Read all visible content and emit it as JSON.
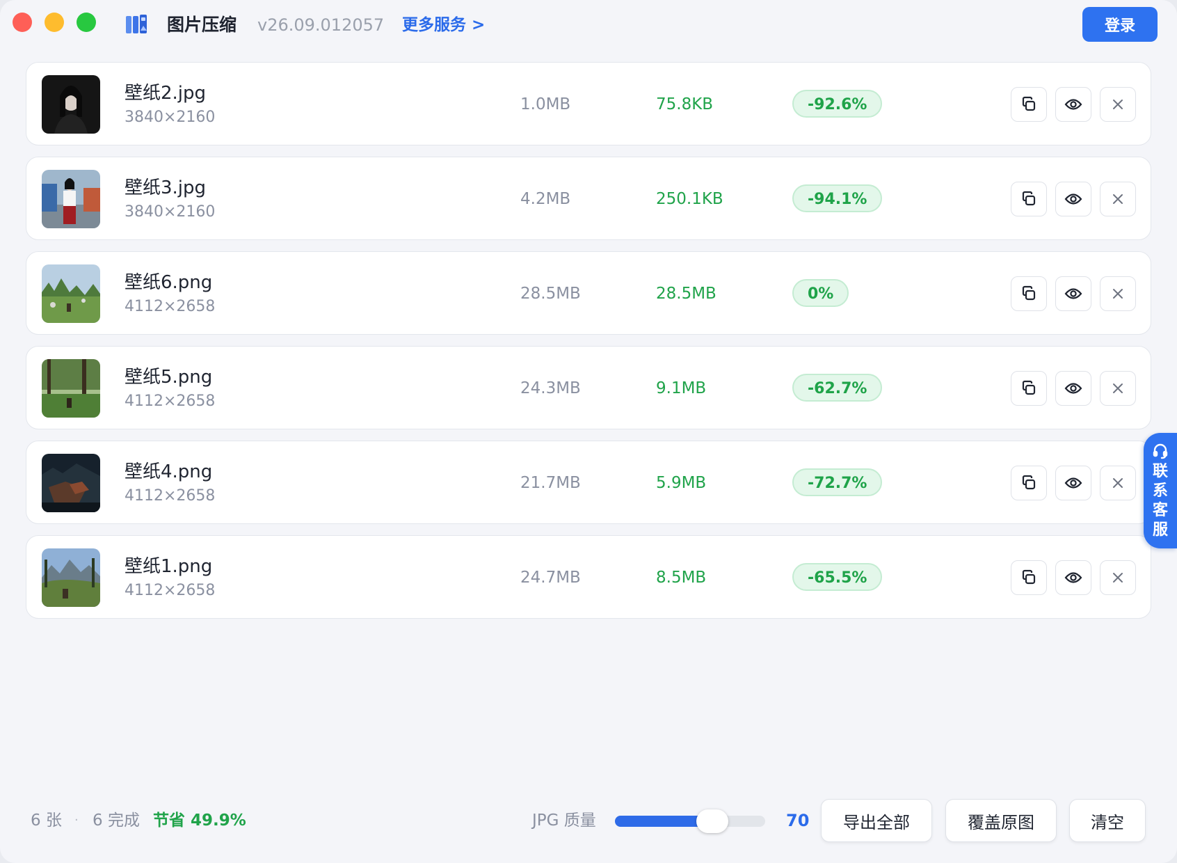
{
  "app": {
    "title": "图片压缩",
    "version": "v26.09.012057",
    "more_services": "更多服务 >",
    "login": "登录"
  },
  "files": [
    {
      "name": "壁纸2.jpg",
      "dims": "3840×2160",
      "orig": "1.0MB",
      "new": "75.8KB",
      "ratio": "-92.6%",
      "thumb": "portrait-dark"
    },
    {
      "name": "壁纸3.jpg",
      "dims": "3840×2160",
      "orig": "4.2MB",
      "new": "250.1KB",
      "ratio": "-94.1%",
      "thumb": "portrait-street"
    },
    {
      "name": "壁纸6.png",
      "dims": "4112×2658",
      "orig": "28.5MB",
      "new": "28.5MB",
      "ratio": "0%",
      "thumb": "landscape-meadow"
    },
    {
      "name": "壁纸5.png",
      "dims": "4112×2658",
      "orig": "24.3MB",
      "new": "9.1MB",
      "ratio": "-62.7%",
      "thumb": "landscape-forest"
    },
    {
      "name": "壁纸4.png",
      "dims": "4112×2658",
      "orig": "21.7MB",
      "new": "5.9MB",
      "ratio": "-72.7%",
      "thumb": "landscape-night"
    },
    {
      "name": "壁纸1.png",
      "dims": "4112×2658",
      "orig": "24.7MB",
      "new": "8.5MB",
      "ratio": "-65.5%",
      "thumb": "landscape-mountain"
    }
  ],
  "row_actions": {
    "copy_icon": "copy-icon",
    "preview_icon": "eye-icon",
    "remove_icon": "close-icon"
  },
  "contact": {
    "label": "联系客服",
    "icon": "headset-icon"
  },
  "footer": {
    "count": "6 张",
    "separator": "·",
    "done": "6 完成",
    "saved": "节省 49.9%",
    "quality_label": "JPG 质量",
    "quality_value": "70",
    "quality_fraction": 0.65,
    "export_all": "导出全部",
    "overwrite": "覆盖原图",
    "clear": "清空"
  },
  "colors": {
    "accent": "#2e72f0",
    "success": "#20a34a",
    "badge_bg": "#e3f7ea",
    "muted_text": "#8a90a0"
  }
}
